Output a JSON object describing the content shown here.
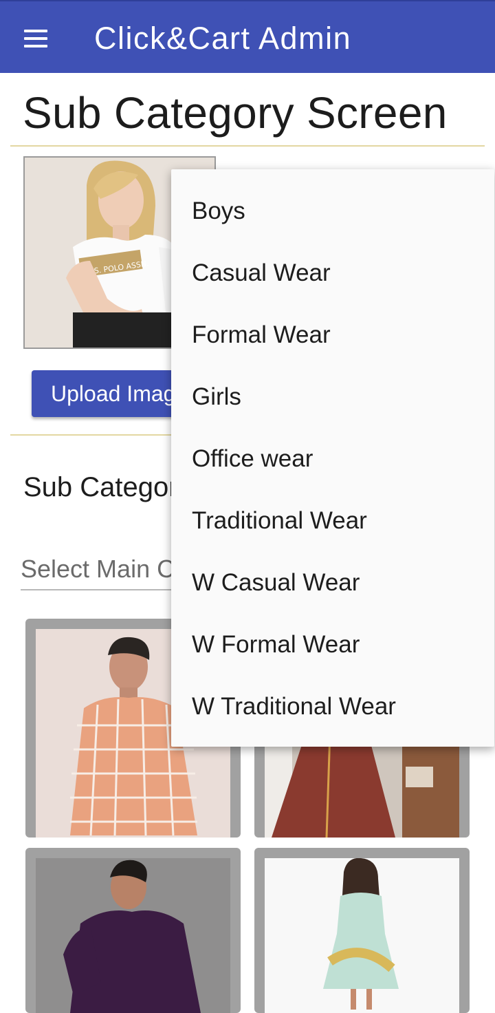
{
  "appbar": {
    "title": "Click&Cart Admin",
    "color": "#3f51b5"
  },
  "page": {
    "title": "Sub Category Screen"
  },
  "upload": {
    "button_label": "Upload Image"
  },
  "form": {
    "section_label": "Sub Category",
    "main_category_placeholder": "Select Main Category"
  },
  "dropdown": {
    "options": [
      "Boys",
      "Casual Wear",
      "Formal Wear",
      "Girls",
      "Office wear",
      "Traditional Wear",
      "W Casual Wear",
      "W Formal Wear",
      "W Traditional Wear"
    ]
  },
  "icons": {
    "menu": "menu-icon",
    "preview": "tshirt-model-image",
    "cards": [
      "checked-shirt-image",
      "brown-dress-image",
      "purple-shirt-image",
      "girls-dress-image"
    ]
  }
}
